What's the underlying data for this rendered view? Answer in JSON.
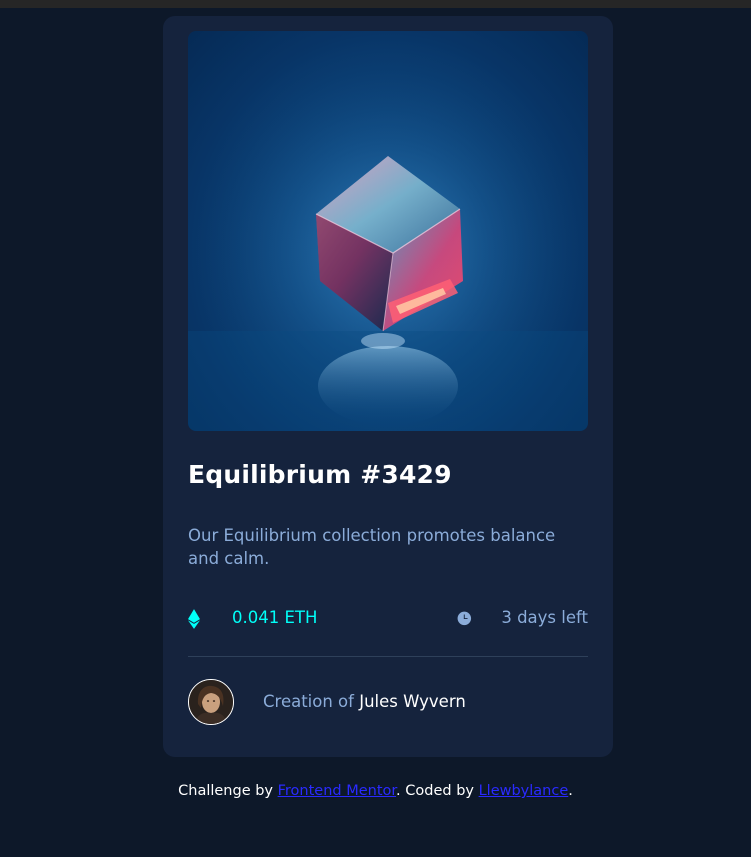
{
  "card": {
    "image_alt": "Equilibrium crystal cube",
    "title": "Equilibrium #3429",
    "description": "Our Equilibrium collection promotes balance and calm.",
    "price": "0.041 ETH",
    "time_left": "3 days left",
    "creator_prefix": "Creation of ",
    "creator_name": "Jules Wyvern"
  },
  "footer": {
    "text_1": "Challenge by ",
    "link_1": "Frontend Mentor",
    "text_2": ". Coded by ",
    "link_2": "Llewbylance",
    "text_3": "."
  },
  "colors": {
    "page_bg": "#0d1829",
    "card_bg": "#15233d",
    "accent_cyan": "#00fff8",
    "soft_blue": "#8bacd9",
    "white": "#ffffff",
    "link": "#2a2aff"
  },
  "icons": [
    "ethereum-icon",
    "clock-icon"
  ]
}
